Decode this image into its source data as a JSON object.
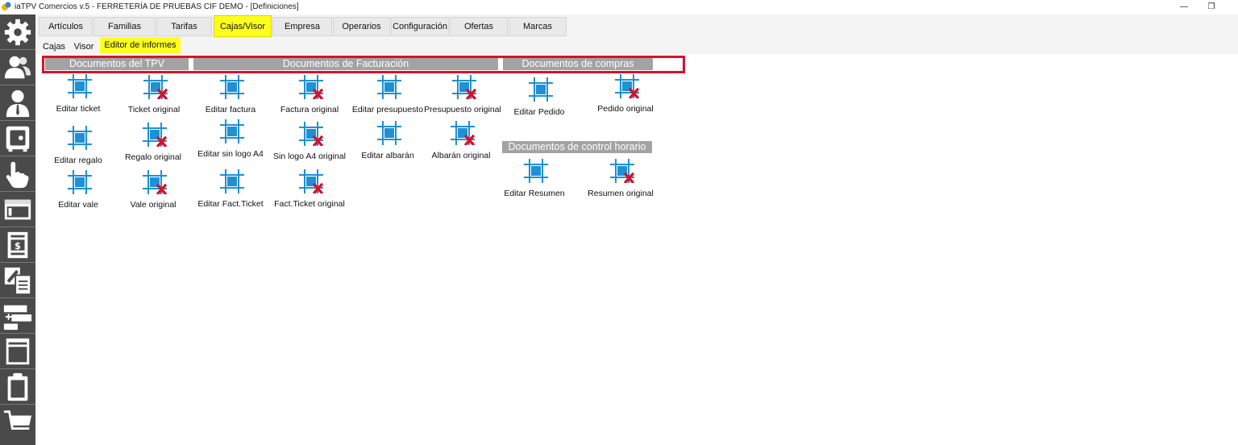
{
  "window": {
    "title": "iaTPV Comercios v.5 - FERRETERÍA DE PRUEBAS CIF DEMO - [Definiciones]",
    "minimize_glyph": "—",
    "restore_glyph": "❐"
  },
  "sidebar": {
    "items": [
      {
        "icon": "gear-icon"
      },
      {
        "icon": "users-icon"
      },
      {
        "icon": "user-icon"
      },
      {
        "icon": "safe-icon"
      },
      {
        "icon": "hand-pointer-icon"
      },
      {
        "icon": "window-icon"
      },
      {
        "icon": "receipt-icon"
      },
      {
        "icon": "copy-clipboard-icon"
      },
      {
        "icon": "add-bar-icon"
      },
      {
        "icon": "list-icon"
      },
      {
        "icon": "clipboard-icon"
      },
      {
        "icon": "cart-icon"
      }
    ]
  },
  "tabs": [
    "Artículos",
    "Familias",
    "Tarifas",
    "Cajas/Visor",
    "Empresa",
    "Operarios",
    "Configuración",
    "Ofertas",
    "Marcas"
  ],
  "active_tab": "Cajas/Visor",
  "subtabs": [
    "Cajas",
    "Visor",
    "Editor de informes"
  ],
  "active_subtab": "Editor de informes",
  "sections": {
    "tpv": "Documentos del TPV",
    "facturacion": "Documentos de Facturación",
    "compras": "Documentos de compras",
    "control_horario": "Documentos de control horario"
  },
  "items": {
    "editar_ticket": "Editar ticket",
    "ticket_original": "Ticket original",
    "editar_factura": "Editar factura",
    "factura_original": "Factura original",
    "editar_presupuesto": "Editar presupuesto",
    "presupuesto_original": "Presupuesto original",
    "editar_pedido": "Editar Pedido",
    "pedido_original": "Pedido original",
    "editar_regalo": "Editar regalo",
    "regalo_original": "Regalo original",
    "editar_sin_logo": "Editar sin logo A4",
    "sin_logo_original": "Sin logo A4 original",
    "editar_albaran": "Editar albarán",
    "albaran_original": "Albarán original",
    "editar_vale": "Editar vale",
    "vale_original": "Vale original",
    "editar_fact_ticket": "Editar Fact.Ticket",
    "fact_ticket_original": "Fact.Ticket original",
    "editar_resumen": "Editar Resumen",
    "resumen_original": "Resumen original"
  },
  "colors": {
    "active_tab": "#ffff1e",
    "highlight_border": "#d8112a",
    "section_header": "#a3a3a3",
    "icon_blue": "#1e90d6",
    "x_red": "#d8112a"
  }
}
